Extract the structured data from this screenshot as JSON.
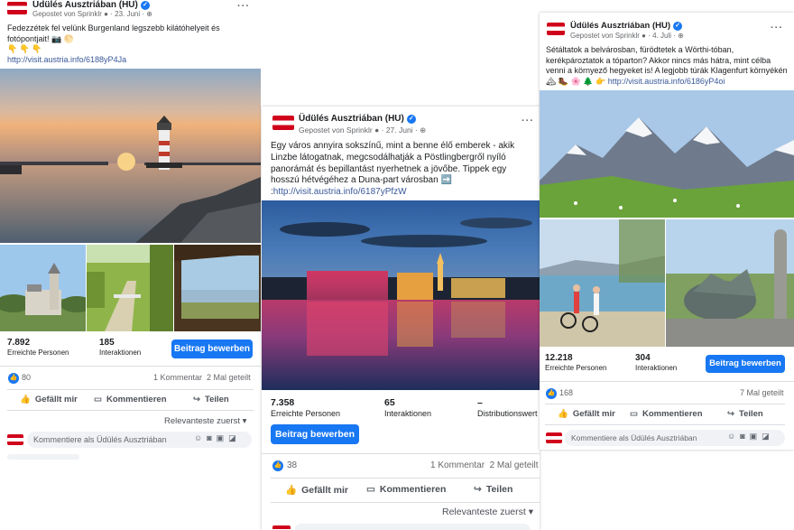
{
  "posts": [
    {
      "page_name": "Üdülés Ausztriában (HU)",
      "posted_via": "Gepostet von Sprinklr",
      "date": "23. Juni",
      "text": "Fedezzétek fel velünk Burgenland legszebb kilátóhelyeit és fotópontjait! 📷 🌕",
      "emoji_line": "👇 👇 👇",
      "link": "http://visit.austria.info/6188yP4Ja",
      "reach_value": "7.892",
      "reach_label": "Erreichte Personen",
      "interactions_value": "185",
      "interactions_label": "Interaktionen",
      "boost_label": "Beitrag bewerben",
      "like_count": "80",
      "comments": "1 Kommentar",
      "shares": "2 Mal geteilt",
      "like_label": "Gefällt mir",
      "comment_label": "Kommentieren",
      "share_label": "Teilen",
      "sort_label": "Relevanteste zuerst",
      "comment_placeholder": "Kommentiere als Üdülés Ausztriában"
    },
    {
      "page_name": "Üdülés Ausztriában (HU)",
      "posted_via": "Gepostet von Sprinklr",
      "date": "27. Juni",
      "text": "Egy város annyira sokszínű, mint a benne élő emberek - akik Linzbe látogatnak, megcsodálhatják a Pöstlingbergről nyíló panorámát és bepillantást nyerhetnek a jövőbe. Tippek egy hosszú hétvégéhez a Duna-part városban ➡️ :",
      "link": "http://visit.austria.info/6187yPfzW",
      "reach_value": "7.358",
      "reach_label": "Erreichte Personen",
      "interactions_value": "65",
      "interactions_label": "Interaktionen",
      "distribution_value": "–",
      "distribution_label": "Distributionswert",
      "boost_label": "Beitrag bewerben",
      "like_count": "38",
      "comments": "1 Kommentar",
      "shares": "2 Mal geteilt",
      "like_label": "Gefällt mir",
      "comment_label": "Kommentieren",
      "share_label": "Teilen",
      "sort_label": "Relevanteste zuerst"
    },
    {
      "page_name": "Üdülés Ausztriában (HU)",
      "posted_via": "Gepostet von Sprinklr",
      "date": "4. Juli",
      "text": "Sétáltatok a belvárosban, fürödtetek a Wörthi-tóban, kerékpároztatok a tóparton? Akkor nincs más hátra, mint célba venni a környező hegyeket is! A legjobb túrák Klagenfurt környékén 🏔 🥾 🌸 🌲 👉",
      "link": "http://visit.austria.info/6186yP4oi",
      "reach_value": "12.218",
      "reach_label": "Erreichte Personen",
      "interactions_value": "304",
      "interactions_label": "Interaktionen",
      "boost_label": "Beitrag bewerben",
      "like_count": "168",
      "shares": "7 Mal geteilt",
      "like_label": "Gefällt mir",
      "comment_label": "Kommentieren",
      "share_label": "Teilen",
      "comment_placeholder": "Kommentiere als Üdülés Ausztriában"
    }
  ],
  "colors": {
    "accent": "#1877f2",
    "link": "#385898",
    "flag_red": "#d0021b",
    "muted": "#65676b"
  },
  "icons": {
    "verified": "verified-badge-icon",
    "globe": "globe-icon",
    "like": "thumbs-up-icon",
    "comment": "speech-bubble-icon",
    "share": "share-arrow-icon",
    "more": "more-dots-icon"
  }
}
